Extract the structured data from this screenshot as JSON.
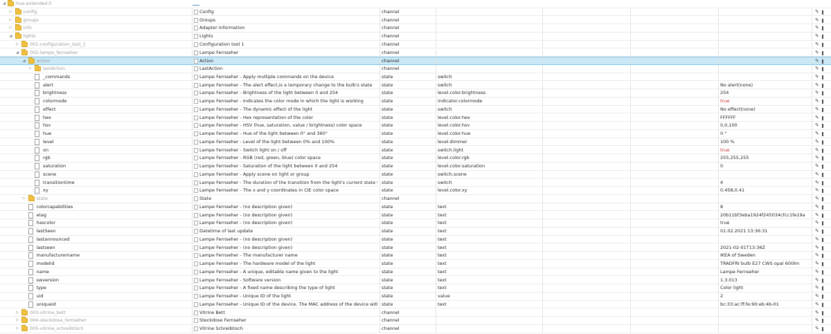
{
  "header": {
    "root_label": "hue-extended.0"
  },
  "rows": [
    {
      "id": "config",
      "depth": 1,
      "kind": "folder",
      "expanded": false,
      "name": "Config",
      "type": "channel",
      "role": "",
      "value": ""
    },
    {
      "id": "groups",
      "depth": 1,
      "kind": "folder",
      "expanded": false,
      "name": "Groups",
      "type": "channel",
      "role": "",
      "value": ""
    },
    {
      "id": "info",
      "depth": 1,
      "kind": "folder",
      "expanded": false,
      "name": "Adapter Information",
      "type": "channel",
      "role": "",
      "value": ""
    },
    {
      "id": "lights",
      "depth": 1,
      "kind": "folder",
      "expanded": true,
      "name": "Lights",
      "type": "channel",
      "role": "",
      "value": ""
    },
    {
      "id": "001-configuration_tool_1",
      "depth": 2,
      "kind": "folder",
      "expanded": false,
      "name": "Configuration tool 1",
      "type": "channel",
      "role": "",
      "value": ""
    },
    {
      "id": "002-lampe_fernseher",
      "depth": 2,
      "kind": "folder",
      "expanded": true,
      "name": "Lampe Fernseher",
      "type": "channel",
      "role": "",
      "value": ""
    },
    {
      "id": "action",
      "depth": 3,
      "kind": "folder",
      "expanded": true,
      "name": "Action",
      "type": "channel",
      "role": "",
      "value": "",
      "selected": true
    },
    {
      "id": "lastAction",
      "depth": 4,
      "kind": "folder",
      "expanded": false,
      "name": "LastAction",
      "type": "channel",
      "role": "",
      "value": ""
    },
    {
      "id": "_commands",
      "depth": 4,
      "kind": "state",
      "name": "Lampe Fernseher - Apply multiple commands on the device",
      "type": "state",
      "role": "switch",
      "value": ""
    },
    {
      "id": "alert",
      "depth": 4,
      "kind": "state",
      "name": "Lampe Fernseher - The alert effect,is a temporary change to the bulb's state",
      "type": "state",
      "role": "switch",
      "value": "No alert(none)"
    },
    {
      "id": "brightness",
      "depth": 4,
      "kind": "state",
      "name": "Lampe Fernseher - Brightness of the light between 0 and 254",
      "type": "state",
      "role": "level.color.brightness",
      "value": "254"
    },
    {
      "id": "colormode",
      "depth": 4,
      "kind": "state",
      "name": "Lampe Fernseher - Indicates the color mode in which the light is working",
      "type": "state",
      "role": "indicator.colormode",
      "value": "true",
      "bool": true
    },
    {
      "id": "effect",
      "depth": 4,
      "kind": "state",
      "name": "Lampe Fernseher - The dynamic effect of the light",
      "type": "state",
      "role": "switch",
      "value": "No effect(none)"
    },
    {
      "id": "hex",
      "depth": 4,
      "kind": "state",
      "name": "Lampe Fernseher - Hex representation of the color",
      "type": "state",
      "role": "level.color.hex",
      "value": "FFFFFF"
    },
    {
      "id": "hsv",
      "depth": 4,
      "kind": "state",
      "name": "Lampe Fernseher - HSV (hue, saturation, value / brightness) color space",
      "type": "state",
      "role": "level.color.hsv",
      "value": "0,0,100"
    },
    {
      "id": "hue",
      "depth": 4,
      "kind": "state",
      "name": "Lampe Fernseher - Hue of the light between 0° and 360°",
      "type": "state",
      "role": "level.color.hue",
      "value": "0 °"
    },
    {
      "id": "level",
      "depth": 4,
      "kind": "state",
      "name": "Lampe Fernseher - Level of the light between 0% and 100%",
      "type": "state",
      "role": "level.dimmer",
      "value": "100 %"
    },
    {
      "id": "on",
      "depth": 4,
      "kind": "state",
      "name": "Lampe Fernseher - Switch light on / off",
      "type": "state",
      "role": "switch.light",
      "value": "true",
      "bool": true
    },
    {
      "id": "rgb",
      "depth": 4,
      "kind": "state",
      "name": "Lampe Fernseher - RGB (red, green, blue) color space",
      "type": "state",
      "role": "level.color.rgb",
      "value": "255,255,255"
    },
    {
      "id": "saturation",
      "depth": 4,
      "kind": "state",
      "name": "Lampe Fernseher - Saturation of the light between 0 and 254",
      "type": "state",
      "role": "level.color.saturation",
      "value": "0"
    },
    {
      "id": "scene",
      "depth": 4,
      "kind": "state",
      "name": "Lampe Fernseher - Apply scene on light or group",
      "type": "state",
      "role": "switch.scene",
      "value": ""
    },
    {
      "id": "transitiontime",
      "depth": 4,
      "kind": "state",
      "name": "Lampe Fernseher - The duration of the transition from the light's current state to the new st...",
      "type": "state",
      "role": "switch",
      "value": "4"
    },
    {
      "id": "xy",
      "depth": 4,
      "kind": "state",
      "name": "Lampe Fernseher - The x and y coordinates in CIE color space",
      "type": "state",
      "role": "level.color.xy",
      "value": "0.458,0.41"
    },
    {
      "id": "state",
      "depth": 3,
      "kind": "folder",
      "expanded": false,
      "name": "State",
      "type": "channel",
      "role": "",
      "value": ""
    },
    {
      "id": "colorcapabilities",
      "depth": 3,
      "kind": "state",
      "name": "Lampe Fernseher - (no description given)",
      "type": "state",
      "role": "text",
      "value": "8"
    },
    {
      "id": "etag",
      "depth": 3,
      "kind": "state",
      "name": "Lampe Fernseher - (no description given)",
      "type": "state",
      "role": "text",
      "value": "20b11bf3eba1924f245034cfcc1fe19a"
    },
    {
      "id": "hascolor",
      "depth": 3,
      "kind": "state",
      "name": "Lampe Fernseher - (no description given)",
      "type": "state",
      "role": "text",
      "value": "true"
    },
    {
      "id": "lastSeen",
      "depth": 3,
      "kind": "state",
      "name": "Datetime of last update",
      "type": "state",
      "role": "text",
      "value": "01.02.2021 13:36:31"
    },
    {
      "id": "lastannounced",
      "depth": 3,
      "kind": "state",
      "name": "Lampe Fernseher - (no description given)",
      "type": "state",
      "role": "text",
      "value": ""
    },
    {
      "id": "lastseen",
      "depth": 3,
      "kind": "state",
      "name": "Lampe Fernseher - (no description given)",
      "type": "state",
      "role": "text",
      "value": "2021-02-01T13:36Z"
    },
    {
      "id": "manufacturername",
      "depth": 3,
      "kind": "state",
      "name": "Lampe Fernseher - The manufacturer name",
      "type": "state",
      "role": "text",
      "value": "IKEA of Sweden"
    },
    {
      "id": "modelid",
      "depth": 3,
      "kind": "state",
      "name": "Lampe Fernseher - The hardware model of the light",
      "type": "state",
      "role": "text",
      "value": "TRADFRI bulb E27 CWS opal 600lm"
    },
    {
      "id": "name",
      "depth": 3,
      "kind": "state",
      "name": "Lampe Fernseher - A unique, editable name given to the light",
      "type": "state",
      "role": "text",
      "value": "Lampe Fernseher"
    },
    {
      "id": "swversion",
      "depth": 3,
      "kind": "state",
      "name": "Lampe Fernseher - Software version",
      "type": "state",
      "role": "text",
      "value": "1.3.013"
    },
    {
      "id": "type",
      "depth": 3,
      "kind": "state",
      "name": "Lampe Fernseher - A fixed name describing the type of light",
      "type": "state",
      "role": "text",
      "value": "Color light"
    },
    {
      "id": "uid",
      "depth": 3,
      "kind": "state",
      "name": "Lampe Fernseher - Unique ID of the light",
      "type": "state",
      "role": "value",
      "value": "2"
    },
    {
      "id": "uniqueid",
      "depth": 3,
      "kind": "state",
      "name": "Lampe Fernseher - Unique ID of the device. The MAC address of the device with a unique e...",
      "type": "state",
      "role": "text",
      "value": "bc:33:ac:ff:fe:90:eb:4b-01"
    },
    {
      "id": "003-vitrine_bett",
      "depth": 2,
      "kind": "folder",
      "expanded": false,
      "name": "Vitrine Bett",
      "type": "channel",
      "role": "",
      "value": ""
    },
    {
      "id": "004-steckdose_fernseher",
      "depth": 2,
      "kind": "folder",
      "expanded": false,
      "name": "Steckdose Fernseher",
      "type": "channel",
      "role": "",
      "value": ""
    },
    {
      "id": "005-vitrine_schreibtisch",
      "depth": 2,
      "kind": "folder",
      "expanded": false,
      "name": "Vitrine Schreibtisch",
      "type": "channel",
      "role": "",
      "value": ""
    }
  ]
}
